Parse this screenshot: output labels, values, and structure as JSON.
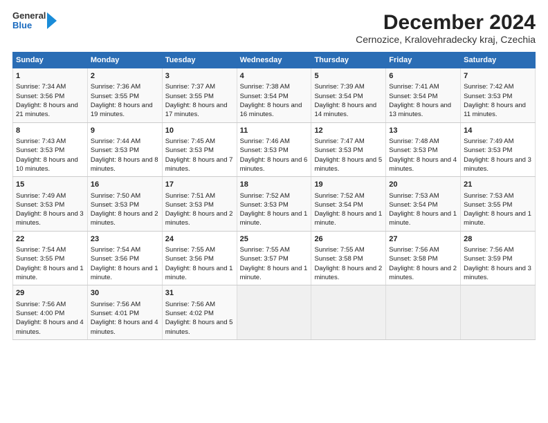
{
  "header": {
    "logo": {
      "line1": "General",
      "line2": "Blue"
    },
    "title": "December 2024",
    "subtitle": "Cernozice, Kralovehradecky kraj, Czechia"
  },
  "calendar": {
    "days_of_week": [
      "Sunday",
      "Monday",
      "Tuesday",
      "Wednesday",
      "Thursday",
      "Friday",
      "Saturday"
    ],
    "weeks": [
      [
        null,
        {
          "day": 2,
          "sunrise": "Sunrise: 7:36 AM",
          "sunset": "Sunset: 3:55 PM",
          "daylight": "Daylight: 8 hours and 19 minutes."
        },
        {
          "day": 3,
          "sunrise": "Sunrise: 7:37 AM",
          "sunset": "Sunset: 3:55 PM",
          "daylight": "Daylight: 8 hours and 17 minutes."
        },
        {
          "day": 4,
          "sunrise": "Sunrise: 7:38 AM",
          "sunset": "Sunset: 3:54 PM",
          "daylight": "Daylight: 8 hours and 16 minutes."
        },
        {
          "day": 5,
          "sunrise": "Sunrise: 7:39 AM",
          "sunset": "Sunset: 3:54 PM",
          "daylight": "Daylight: 8 hours and 14 minutes."
        },
        {
          "day": 6,
          "sunrise": "Sunrise: 7:41 AM",
          "sunset": "Sunset: 3:54 PM",
          "daylight": "Daylight: 8 hours and 13 minutes."
        },
        {
          "day": 7,
          "sunrise": "Sunrise: 7:42 AM",
          "sunset": "Sunset: 3:53 PM",
          "daylight": "Daylight: 8 hours and 11 minutes."
        }
      ],
      [
        {
          "day": 8,
          "sunrise": "Sunrise: 7:43 AM",
          "sunset": "Sunset: 3:53 PM",
          "daylight": "Daylight: 8 hours and 10 minutes."
        },
        {
          "day": 9,
          "sunrise": "Sunrise: 7:44 AM",
          "sunset": "Sunset: 3:53 PM",
          "daylight": "Daylight: 8 hours and 8 minutes."
        },
        {
          "day": 10,
          "sunrise": "Sunrise: 7:45 AM",
          "sunset": "Sunset: 3:53 PM",
          "daylight": "Daylight: 8 hours and 7 minutes."
        },
        {
          "day": 11,
          "sunrise": "Sunrise: 7:46 AM",
          "sunset": "Sunset: 3:53 PM",
          "daylight": "Daylight: 8 hours and 6 minutes."
        },
        {
          "day": 12,
          "sunrise": "Sunrise: 7:47 AM",
          "sunset": "Sunset: 3:53 PM",
          "daylight": "Daylight: 8 hours and 5 minutes."
        },
        {
          "day": 13,
          "sunrise": "Sunrise: 7:48 AM",
          "sunset": "Sunset: 3:53 PM",
          "daylight": "Daylight: 8 hours and 4 minutes."
        },
        {
          "day": 14,
          "sunrise": "Sunrise: 7:49 AM",
          "sunset": "Sunset: 3:53 PM",
          "daylight": "Daylight: 8 hours and 3 minutes."
        }
      ],
      [
        {
          "day": 15,
          "sunrise": "Sunrise: 7:49 AM",
          "sunset": "Sunset: 3:53 PM",
          "daylight": "Daylight: 8 hours and 3 minutes."
        },
        {
          "day": 16,
          "sunrise": "Sunrise: 7:50 AM",
          "sunset": "Sunset: 3:53 PM",
          "daylight": "Daylight: 8 hours and 2 minutes."
        },
        {
          "day": 17,
          "sunrise": "Sunrise: 7:51 AM",
          "sunset": "Sunset: 3:53 PM",
          "daylight": "Daylight: 8 hours and 2 minutes."
        },
        {
          "day": 18,
          "sunrise": "Sunrise: 7:52 AM",
          "sunset": "Sunset: 3:53 PM",
          "daylight": "Daylight: 8 hours and 1 minute."
        },
        {
          "day": 19,
          "sunrise": "Sunrise: 7:52 AM",
          "sunset": "Sunset: 3:54 PM",
          "daylight": "Daylight: 8 hours and 1 minute."
        },
        {
          "day": 20,
          "sunrise": "Sunrise: 7:53 AM",
          "sunset": "Sunset: 3:54 PM",
          "daylight": "Daylight: 8 hours and 1 minute."
        },
        {
          "day": 21,
          "sunrise": "Sunrise: 7:53 AM",
          "sunset": "Sunset: 3:55 PM",
          "daylight": "Daylight: 8 hours and 1 minute."
        }
      ],
      [
        {
          "day": 22,
          "sunrise": "Sunrise: 7:54 AM",
          "sunset": "Sunset: 3:55 PM",
          "daylight": "Daylight: 8 hours and 1 minute."
        },
        {
          "day": 23,
          "sunrise": "Sunrise: 7:54 AM",
          "sunset": "Sunset: 3:56 PM",
          "daylight": "Daylight: 8 hours and 1 minute."
        },
        {
          "day": 24,
          "sunrise": "Sunrise: 7:55 AM",
          "sunset": "Sunset: 3:56 PM",
          "daylight": "Daylight: 8 hours and 1 minute."
        },
        {
          "day": 25,
          "sunrise": "Sunrise: 7:55 AM",
          "sunset": "Sunset: 3:57 PM",
          "daylight": "Daylight: 8 hours and 1 minute."
        },
        {
          "day": 26,
          "sunrise": "Sunrise: 7:55 AM",
          "sunset": "Sunset: 3:58 PM",
          "daylight": "Daylight: 8 hours and 2 minutes."
        },
        {
          "day": 27,
          "sunrise": "Sunrise: 7:56 AM",
          "sunset": "Sunset: 3:58 PM",
          "daylight": "Daylight: 8 hours and 2 minutes."
        },
        {
          "day": 28,
          "sunrise": "Sunrise: 7:56 AM",
          "sunset": "Sunset: 3:59 PM",
          "daylight": "Daylight: 8 hours and 3 minutes."
        }
      ],
      [
        {
          "day": 29,
          "sunrise": "Sunrise: 7:56 AM",
          "sunset": "Sunset: 4:00 PM",
          "daylight": "Daylight: 8 hours and 4 minutes."
        },
        {
          "day": 30,
          "sunrise": "Sunrise: 7:56 AM",
          "sunset": "Sunset: 4:01 PM",
          "daylight": "Daylight: 8 hours and 4 minutes."
        },
        {
          "day": 31,
          "sunrise": "Sunrise: 7:56 AM",
          "sunset": "Sunset: 4:02 PM",
          "daylight": "Daylight: 8 hours and 5 minutes."
        },
        null,
        null,
        null,
        null
      ]
    ],
    "first_day": {
      "day": 1,
      "sunrise": "Sunrise: 7:34 AM",
      "sunset": "Sunset: 3:56 PM",
      "daylight": "Daylight: 8 hours and 21 minutes."
    }
  }
}
